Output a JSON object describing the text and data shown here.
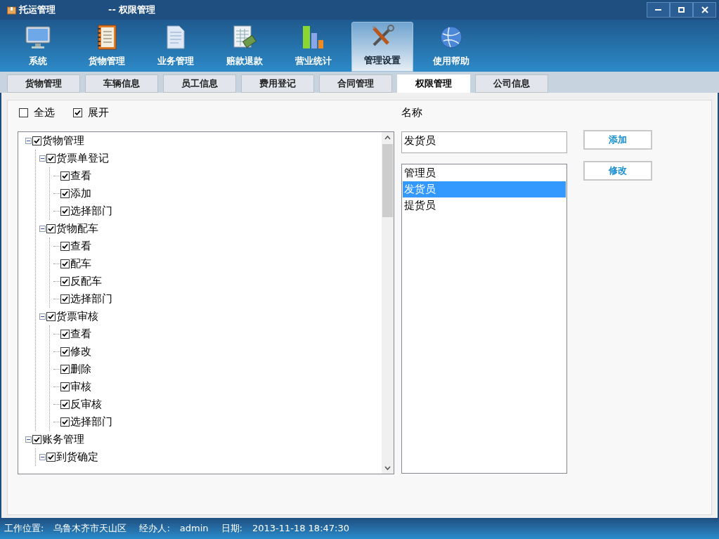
{
  "window": {
    "app_title": "托运管理",
    "page_title": "-- 权限管理"
  },
  "toolbar": [
    {
      "label": "系统",
      "selected": false
    },
    {
      "label": "货物管理",
      "selected": false
    },
    {
      "label": "业务管理",
      "selected": false
    },
    {
      "label": "赔款退款",
      "selected": false
    },
    {
      "label": "营业统计",
      "selected": false
    },
    {
      "label": "管理设置",
      "selected": true
    },
    {
      "label": "使用帮助",
      "selected": false
    }
  ],
  "tabs": [
    {
      "label": "货物管理",
      "selected": false
    },
    {
      "label": "车辆信息",
      "selected": false
    },
    {
      "label": "员工信息",
      "selected": false
    },
    {
      "label": "费用登记",
      "selected": false
    },
    {
      "label": "合同管理",
      "selected": false
    },
    {
      "label": "权限管理",
      "selected": true
    },
    {
      "label": "公司信息",
      "selected": false
    }
  ],
  "options": [
    {
      "label": "全选",
      "checked": false
    },
    {
      "label": "展开",
      "checked": true
    }
  ],
  "tree": [
    {
      "label": "货物管理",
      "checked": true,
      "expanded": true,
      "children": [
        {
          "label": "货票单登记",
          "checked": true,
          "expanded": true,
          "children": [
            {
              "label": "查看",
              "checked": true
            },
            {
              "label": "添加",
              "checked": true
            },
            {
              "label": "选择部门",
              "checked": true
            }
          ]
        },
        {
          "label": "货物配车",
          "checked": true,
          "expanded": true,
          "children": [
            {
              "label": "查看",
              "checked": true
            },
            {
              "label": "配车",
              "checked": true
            },
            {
              "label": "反配车",
              "checked": true
            },
            {
              "label": "选择部门",
              "checked": true
            }
          ]
        },
        {
          "label": "货票审核",
          "checked": true,
          "expanded": true,
          "children": [
            {
              "label": "查看",
              "checked": true
            },
            {
              "label": "修改",
              "checked": true
            },
            {
              "label": "删除",
              "checked": true
            },
            {
              "label": "审核",
              "checked": true
            },
            {
              "label": "反审核",
              "checked": true
            },
            {
              "label": "选择部门",
              "checked": true
            }
          ]
        }
      ]
    },
    {
      "label": "账务管理",
      "checked": true,
      "expanded": true,
      "children": [
        {
          "label": "到货确定",
          "checked": true,
          "expanded": true
        }
      ]
    }
  ],
  "name_label": "名称",
  "name_field": {
    "value": "发货员"
  },
  "roles": [
    {
      "label": "管理员",
      "selected": false
    },
    {
      "label": "发货员",
      "selected": true
    },
    {
      "label": "提货员",
      "selected": false
    }
  ],
  "buttons": [
    "添加",
    "修改"
  ],
  "status_bar": [
    {
      "label": "工作位置:",
      "value": "乌鲁木齐市天山区"
    },
    {
      "label": "经办人:",
      "value": "admin"
    },
    {
      "label": "日期:",
      "value": "2013-11-18 18:47:30"
    }
  ]
}
